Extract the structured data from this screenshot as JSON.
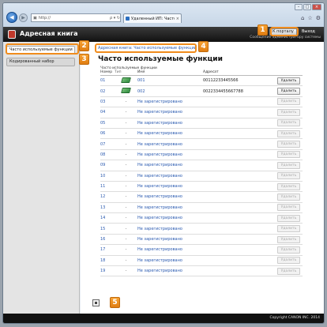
{
  "browser": {
    "window_buttons": [
      "–",
      "□",
      "×"
    ],
    "address": "http://",
    "address_icons": "ρ ▾ ↻",
    "tab_label": "Удаленный ИП: Часто исп...",
    "tab_close": "×",
    "tools": [
      "⌂",
      "☆",
      "⚙"
    ]
  },
  "header": {
    "app_title": "Адресная книга",
    "portal_button": "К порталу",
    "logout": "Выход",
    "admin_message": "Сообщение администратору системы"
  },
  "sidebar": {
    "items": [
      {
        "label": "Часто используемые функции"
      },
      {
        "label": "Кодированный набор"
      }
    ]
  },
  "main": {
    "breadcrumb": "Адресная книга: Часто используемые функции",
    "title": "Часто используемые функции",
    "section_label": "Часто используемые функции",
    "columns": {
      "num": "Номер",
      "type": "Тип",
      "name": "Имя",
      "addr": "Адресат"
    }
  },
  "rows": [
    {
      "num": "01",
      "type": "icon",
      "name": "001",
      "addr": "00112233445566",
      "action": "Удалить",
      "enabled": true
    },
    {
      "num": "02",
      "type": "icon",
      "name": "002",
      "addr": "0022334455667788",
      "action": "Удалить",
      "enabled": true
    },
    {
      "num": "03",
      "type": "-",
      "name": "Не зарегистрировано",
      "addr": "",
      "action": "Удалить",
      "enabled": false
    },
    {
      "num": "04",
      "type": "-",
      "name": "Не зарегистрировано",
      "addr": "",
      "action": "Удалить",
      "enabled": false
    },
    {
      "num": "05",
      "type": "-",
      "name": "Не зарегистрировано",
      "addr": "",
      "action": "Удалить",
      "enabled": false
    },
    {
      "num": "06",
      "type": "-",
      "name": "Не зарегистрировано",
      "addr": "",
      "action": "Удалить",
      "enabled": false
    },
    {
      "num": "07",
      "type": "-",
      "name": "Не зарегистрировано",
      "addr": "",
      "action": "Удалить",
      "enabled": false
    },
    {
      "num": "08",
      "type": "-",
      "name": "Не зарегистрировано",
      "addr": "",
      "action": "Удалить",
      "enabled": false
    },
    {
      "num": "09",
      "type": "-",
      "name": "Не зарегистрировано",
      "addr": "",
      "action": "Удалить",
      "enabled": false
    },
    {
      "num": "10",
      "type": "-",
      "name": "Не зарегистрировано",
      "addr": "",
      "action": "Удалить",
      "enabled": false
    },
    {
      "num": "11",
      "type": "-",
      "name": "Не зарегистрировано",
      "addr": "",
      "action": "Удалить",
      "enabled": false
    },
    {
      "num": "12",
      "type": "-",
      "name": "Не зарегистрировано",
      "addr": "",
      "action": "Удалить",
      "enabled": false
    },
    {
      "num": "13",
      "type": "-",
      "name": "Не зарегистрировано",
      "addr": "",
      "action": "Удалить",
      "enabled": false
    },
    {
      "num": "14",
      "type": "-",
      "name": "Не зарегистрировано",
      "addr": "",
      "action": "Удалить",
      "enabled": false
    },
    {
      "num": "15",
      "type": "-",
      "name": "Не зарегистрировано",
      "addr": "",
      "action": "Удалить",
      "enabled": false
    },
    {
      "num": "16",
      "type": "-",
      "name": "Не зарегистрировано",
      "addr": "",
      "action": "Удалить",
      "enabled": false
    },
    {
      "num": "17",
      "type": "-",
      "name": "Не зарегистрировано",
      "addr": "",
      "action": "Удалить",
      "enabled": false
    },
    {
      "num": "18",
      "type": "-",
      "name": "Не зарегистрировано",
      "addr": "",
      "action": "Удалить",
      "enabled": false
    },
    {
      "num": "19",
      "type": "-",
      "name": "Не зарегистрировано",
      "addr": "",
      "action": "Удалить",
      "enabled": false
    }
  ],
  "callouts": [
    "1",
    "2",
    "3",
    "4",
    "5"
  ],
  "footer": {
    "copyright": "Copyright CANON INC. 2014"
  },
  "colors": {
    "accent": "#f08c1c",
    "link": "#2a5ab0",
    "header_bg": "#111111"
  }
}
